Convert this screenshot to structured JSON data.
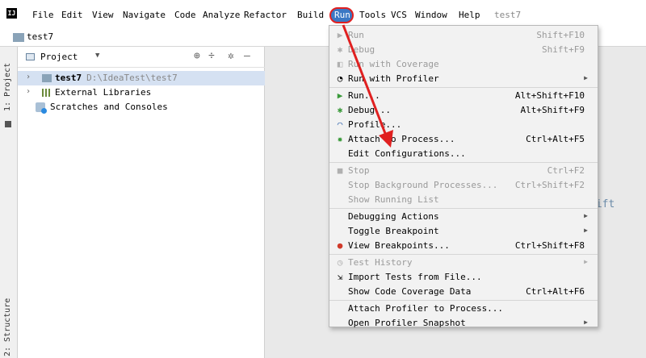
{
  "menubar": {
    "logo": "IJ",
    "items": [
      "File",
      "Edit",
      "View",
      "Navigate",
      "Code",
      "Analyze",
      "Refactor",
      "Build",
      "Run",
      "Tools",
      "VCS",
      "Window",
      "Help"
    ],
    "project_title": "test7"
  },
  "navbar": {
    "project": "test7"
  },
  "left_strip": {
    "project_tab": "1: Project",
    "structure_tab": "2: Structure"
  },
  "project_panel": {
    "title": "Project",
    "tree": [
      {
        "label": "test7",
        "path": "D:\\IdeaTest\\test7"
      },
      {
        "label": "External Libraries"
      },
      {
        "label": "Scratches and Consoles"
      }
    ]
  },
  "editor": {
    "hint": "hift"
  },
  "run_menu": {
    "items": [
      {
        "label": "Run",
        "shortcut": "Shift+F10",
        "icon": "run-icon"
      },
      {
        "label": "Debug",
        "shortcut": "Shift+F9",
        "icon": "debug-icon"
      },
      {
        "label": "Run with Coverage",
        "shortcut": "",
        "icon": "coverage-icon"
      },
      {
        "label": "Run with Profiler",
        "shortcut": "",
        "icon": "profiler-icon"
      },
      {
        "label": "Run...",
        "shortcut": "Alt+Shift+F10",
        "icon": "run-icon"
      },
      {
        "label": "Debug...",
        "shortcut": "Alt+Shift+F9",
        "icon": "debug-icon"
      },
      {
        "label": "Profile...",
        "shortcut": "",
        "icon": "profile-icon"
      },
      {
        "label": "Attach to Process...",
        "shortcut": "Ctrl+Alt+F5",
        "icon": "attach-icon"
      },
      {
        "label": "Edit Configurations...",
        "shortcut": "",
        "icon": ""
      },
      {
        "label": "Stop",
        "shortcut": "Ctrl+F2",
        "icon": "stop-icon"
      },
      {
        "label": "Stop Background Processes...",
        "shortcut": "Ctrl+Shift+F2",
        "icon": ""
      },
      {
        "label": "Show Running List",
        "shortcut": "",
        "icon": ""
      },
      {
        "label": "Debugging Actions",
        "shortcut": "",
        "icon": ""
      },
      {
        "label": "Toggle Breakpoint",
        "shortcut": "",
        "icon": ""
      },
      {
        "label": "View Breakpoints...",
        "shortcut": "Ctrl+Shift+F8",
        "icon": "breakpoints-icon"
      },
      {
        "label": "Test History",
        "shortcut": "",
        "icon": "history-icon"
      },
      {
        "label": "Import Tests from File...",
        "shortcut": "",
        "icon": "import-icon"
      },
      {
        "label": "Show Code Coverage Data",
        "shortcut": "Ctrl+Alt+F6",
        "icon": ""
      },
      {
        "label": "Attach Profiler to Process...",
        "shortcut": "",
        "icon": ""
      },
      {
        "label": "Open Profiler Snapshot",
        "shortcut": "",
        "icon": ""
      }
    ]
  },
  "colors": {
    "menu_highlight": "#3b78c4",
    "annotation": "#e02020",
    "selection": "#d5e1f2"
  }
}
